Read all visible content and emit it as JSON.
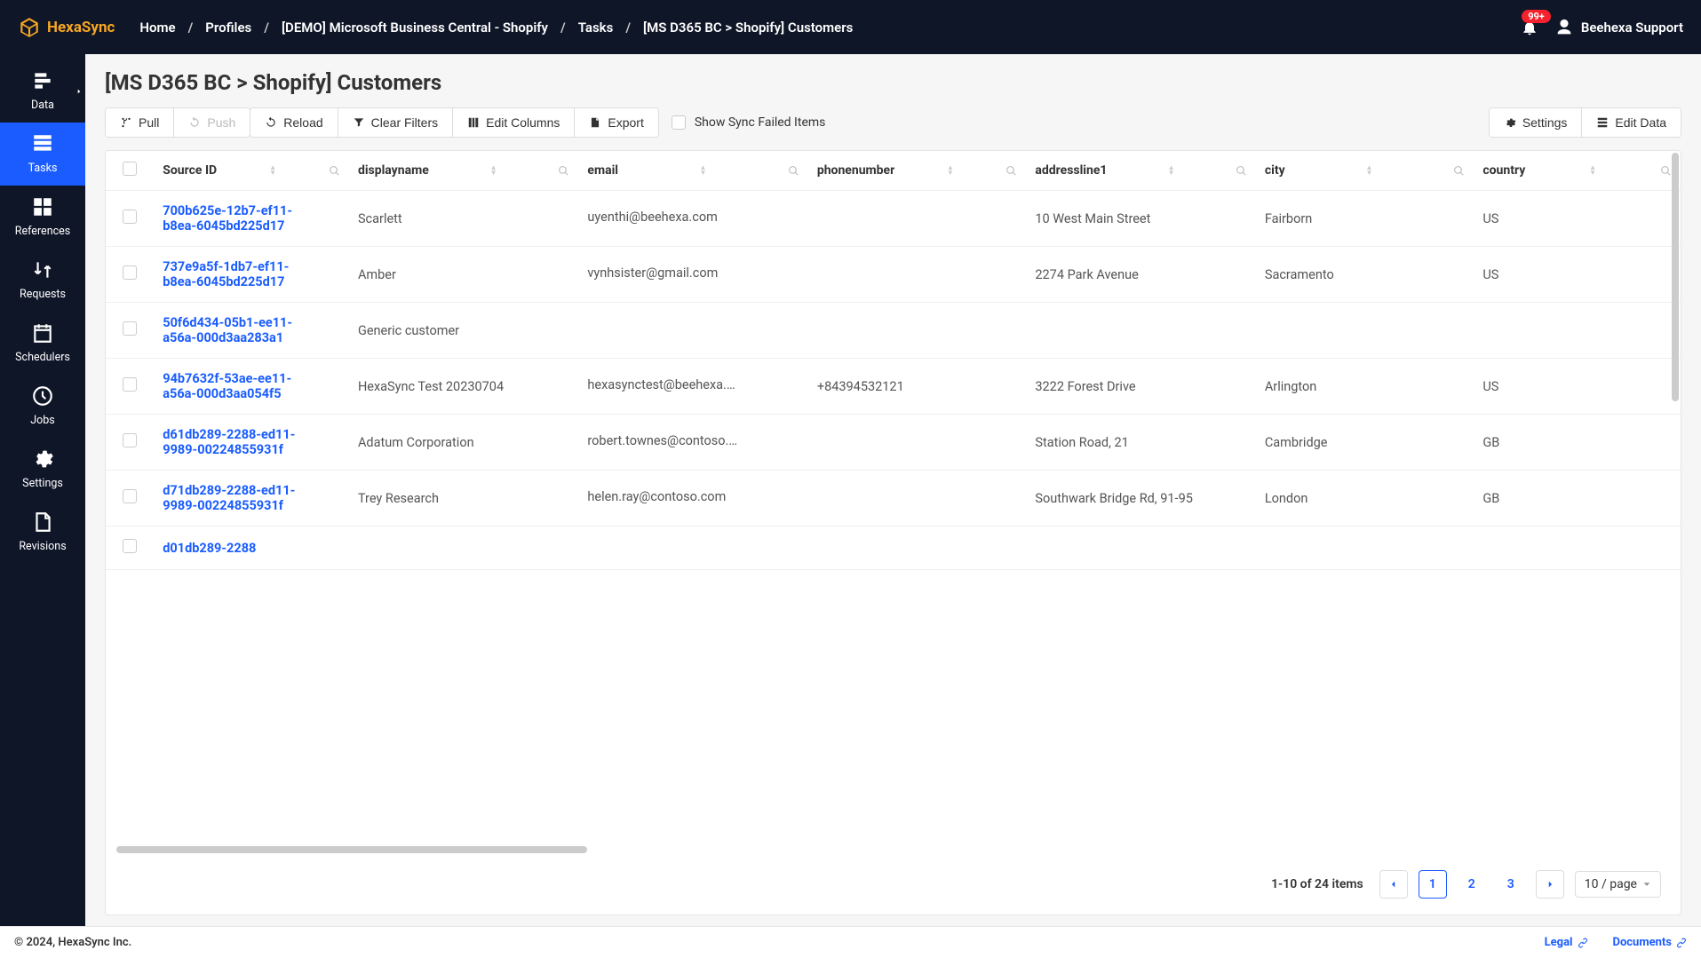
{
  "brand": {
    "name": "HexaSync"
  },
  "breadcrumb": [
    "Home",
    "Profiles",
    "[DEMO] Microsoft Business Central - Shopify",
    "Tasks",
    "[MS D365 BC > Shopify] Customers"
  ],
  "notif_badge": "99+",
  "user_name": "Beehexa Support",
  "sidebar": {
    "items": [
      {
        "label": "Data"
      },
      {
        "label": "Tasks"
      },
      {
        "label": "References"
      },
      {
        "label": "Requests"
      },
      {
        "label": "Schedulers"
      },
      {
        "label": "Jobs"
      },
      {
        "label": "Settings"
      },
      {
        "label": "Revisions"
      }
    ]
  },
  "page_title": "[MS D365 BC > Shopify] Customers",
  "toolbar": {
    "pull": "Pull",
    "push": "Push",
    "reload": "Reload",
    "clear_filters": "Clear Filters",
    "edit_columns": "Edit Columns",
    "export": "Export",
    "show_sync_failed": "Show Sync Failed Items",
    "settings": "Settings",
    "edit_data": "Edit Data"
  },
  "columns": [
    "Source ID",
    "displayname",
    "email",
    "phonenumber",
    "addressline1",
    "city",
    "country"
  ],
  "rows": [
    {
      "source_id": "700b625e-12b7-ef11-b8ea-6045bd225d17",
      "displayname": "Scarlett",
      "email": "uyenthi@beehexa.com",
      "phonenumber": "",
      "addressline1": "10 West Main Street",
      "city": "Fairborn",
      "country": "US"
    },
    {
      "source_id": "737e9a5f-1db7-ef11-b8ea-6045bd225d17",
      "displayname": "Amber",
      "email": "vynhsister@gmail.com",
      "phonenumber": "",
      "addressline1": "2274 Park Avenue",
      "city": "Sacramento",
      "country": "US"
    },
    {
      "source_id": "50f6d434-05b1-ee11-a56a-000d3aa283a1",
      "displayname": "Generic customer",
      "email": "",
      "phonenumber": "",
      "addressline1": "",
      "city": "",
      "country": ""
    },
    {
      "source_id": "94b7632f-53ae-ee11-a56a-000d3aa054f5",
      "displayname": "HexaSync Test 20230704",
      "email": "hexasynctest@beehexa.com",
      "phonenumber": "+84394532121",
      "addressline1": "3222 Forest Drive",
      "city": "Arlington",
      "country": "US"
    },
    {
      "source_id": "d61db289-2288-ed11-9989-00224855931f",
      "displayname": "Adatum Corporation",
      "email": "robert.townes@contoso.c…",
      "phonenumber": "",
      "addressline1": "Station Road, 21",
      "city": "Cambridge",
      "country": "GB"
    },
    {
      "source_id": "d71db289-2288-ed11-9989-00224855931f",
      "displayname": "Trey Research",
      "email": "helen.ray@contoso.com",
      "phonenumber": "",
      "addressline1": "Southwark Bridge Rd, 91-95",
      "city": "London",
      "country": "GB"
    },
    {
      "source_id": "d01db289-2288",
      "displayname": "",
      "email": "",
      "phonenumber": "",
      "addressline1": "",
      "city": "",
      "country": ""
    }
  ],
  "pagination": {
    "info": "1-10 of 24 items",
    "pages": [
      "1",
      "2",
      "3"
    ],
    "size_label": "10 / page"
  },
  "footer": {
    "copyright": "© 2024, HexaSync Inc.",
    "legal": "Legal",
    "documents": "Documents"
  }
}
